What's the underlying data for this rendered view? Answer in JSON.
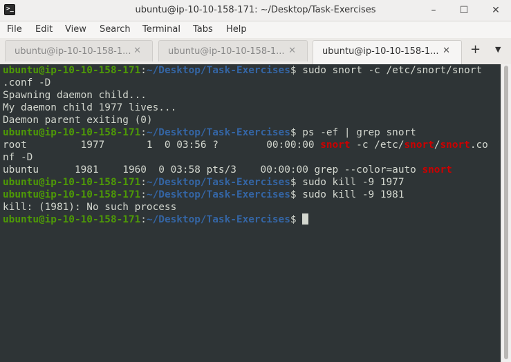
{
  "window": {
    "title": "ubuntu@ip-10-10-158-171: ~/Desktop/Task-Exercises",
    "icon_text": ">_",
    "controls": {
      "minimize": "–",
      "maximize": "☐",
      "close": "✕"
    }
  },
  "menu": [
    "File",
    "Edit",
    "View",
    "Search",
    "Terminal",
    "Tabs",
    "Help"
  ],
  "tabs": [
    {
      "label": "ubuntu@ip-10-10-158-1...",
      "close": "✕",
      "active": false
    },
    {
      "label": "ubuntu@ip-10-10-158-1...",
      "close": "✕",
      "active": false
    },
    {
      "label": "ubuntu@ip-10-10-158-1...",
      "close": "✕",
      "active": true
    }
  ],
  "tabbar": {
    "new_tab": "+",
    "menu": "▼"
  },
  "terminal": {
    "prompt": {
      "user_host": "ubuntu@ip-10-10-158-171",
      "sep": ":",
      "path": "~/Desktop/Task-Exercises",
      "symbol": "$ "
    },
    "lines": [
      {
        "cmd": "sudo snort -c /etc/snort/snort"
      },
      {
        "text": ".conf -D"
      },
      {
        "text": "Spawning daemon child..."
      },
      {
        "text": "My daemon child 1977 lives..."
      },
      {
        "text": "Daemon parent exiting (0)"
      },
      {
        "cmd": "ps -ef | grep snort"
      },
      {
        "text": "root         1977       1  0 03:56 ?        00:00:00 ",
        "hl1": "snort",
        "t2": " -c /etc/",
        "hl2": "snort",
        "t3": "/",
        "hl3": "snort",
        "t4": ".co"
      },
      {
        "text": "nf -D"
      },
      {
        "text": "ubuntu      1981    1960  0 03:58 pts/3    00:00:00 grep --color=auto ",
        "hl1": "snort"
      },
      {
        "cmd": "sudo kill -9 1977"
      },
      {
        "cmd": "sudo kill -9 1981"
      },
      {
        "text": "kill: (1981): No such process"
      },
      {
        "cmd": ""
      }
    ]
  }
}
